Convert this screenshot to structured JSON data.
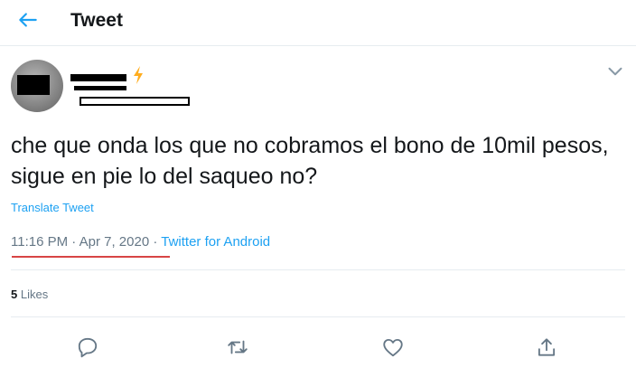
{
  "header": {
    "title": "Tweet",
    "back_icon": "arrow-left-icon"
  },
  "tweet": {
    "text": "che que onda los que no cobramos el bono de 10mil pesos, sigue en pie lo del saqueo no?",
    "translate_label": "Translate Tweet",
    "time": "11:16 PM",
    "date": "Apr 7, 2020",
    "source": "Twitter for Android",
    "separator": "·",
    "likes_count": "5",
    "likes_label": "Likes"
  },
  "icons": {
    "reply": "reply-icon",
    "retweet": "retweet-icon",
    "like": "heart-icon",
    "share": "share-icon",
    "more": "chevron-down-icon",
    "badge": "lightning-icon"
  },
  "colors": {
    "accent": "#1da1f2",
    "text": "#14171a",
    "muted": "#657786",
    "underline": "#d84545",
    "badge": "#ffad1f"
  }
}
